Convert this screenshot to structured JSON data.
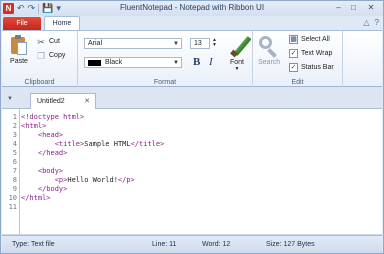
{
  "window": {
    "title": "FluentNotepad - Notepad with Ribbon UI",
    "app_icon_letter": "N",
    "controls": {
      "minimize": "–",
      "maximize": "□",
      "close": "✕"
    }
  },
  "quick_access": {
    "undo": "↶",
    "redo": "↷",
    "save": "💾",
    "more": "▾"
  },
  "tabs": {
    "file": "File",
    "home": "Home",
    "collapse": "△",
    "help": "?"
  },
  "ribbon": {
    "clipboard": {
      "label": "Clipboard",
      "paste": "Paste",
      "cut": "Cut",
      "copy": "Copy"
    },
    "format": {
      "label": "Format",
      "font_name": "Arial",
      "font_size": "13",
      "color_name": "Black",
      "bold": "B",
      "italic": "I",
      "font_button": "Font"
    },
    "edit": {
      "label": "Edit",
      "search": "Search",
      "select_all": "Select All",
      "text_wrap": "Text Wrap",
      "text_wrap_checked": true,
      "status_bar": "Status Bar",
      "status_bar_checked": true
    }
  },
  "document": {
    "tab_name": "Untitled2",
    "lines": [
      {
        "n": "1",
        "parts": [
          {
            "t": "tag",
            "s": "<!doctype html>"
          }
        ]
      },
      {
        "n": "2",
        "parts": [
          {
            "t": "tag",
            "s": "<html>"
          }
        ]
      },
      {
        "n": "3",
        "parts": [
          {
            "t": "txt",
            "s": "    "
          },
          {
            "t": "tag",
            "s": "<head>"
          }
        ]
      },
      {
        "n": "4",
        "parts": [
          {
            "t": "txt",
            "s": "        "
          },
          {
            "t": "tag",
            "s": "<title>"
          },
          {
            "t": "txt",
            "s": "Sample HTML"
          },
          {
            "t": "tag",
            "s": "</title>"
          }
        ]
      },
      {
        "n": "5",
        "parts": [
          {
            "t": "txt",
            "s": "    "
          },
          {
            "t": "tag",
            "s": "</head>"
          }
        ]
      },
      {
        "n": "6",
        "parts": []
      },
      {
        "n": "7",
        "parts": [
          {
            "t": "txt",
            "s": "    "
          },
          {
            "t": "tag",
            "s": "<body>"
          }
        ]
      },
      {
        "n": "8",
        "parts": [
          {
            "t": "txt",
            "s": "        "
          },
          {
            "t": "tag",
            "s": "<p>"
          },
          {
            "t": "txt",
            "s": "Hello World!"
          },
          {
            "t": "tag",
            "s": "</p>"
          }
        ]
      },
      {
        "n": "9",
        "parts": [
          {
            "t": "txt",
            "s": "    "
          },
          {
            "t": "tag",
            "s": "</body>"
          }
        ]
      },
      {
        "n": "10",
        "parts": [
          {
            "t": "tag",
            "s": "</html>"
          }
        ]
      },
      {
        "n": "11",
        "parts": []
      }
    ]
  },
  "status": {
    "type": "Type: Text file",
    "line": "Line: 11",
    "word": "Word: 12",
    "size": "Size: 127 Bytes"
  },
  "colors": {
    "file_tab": "#d2302f",
    "tag": "#8e1d8e",
    "ribbon_bg": "#e9f0f9"
  }
}
